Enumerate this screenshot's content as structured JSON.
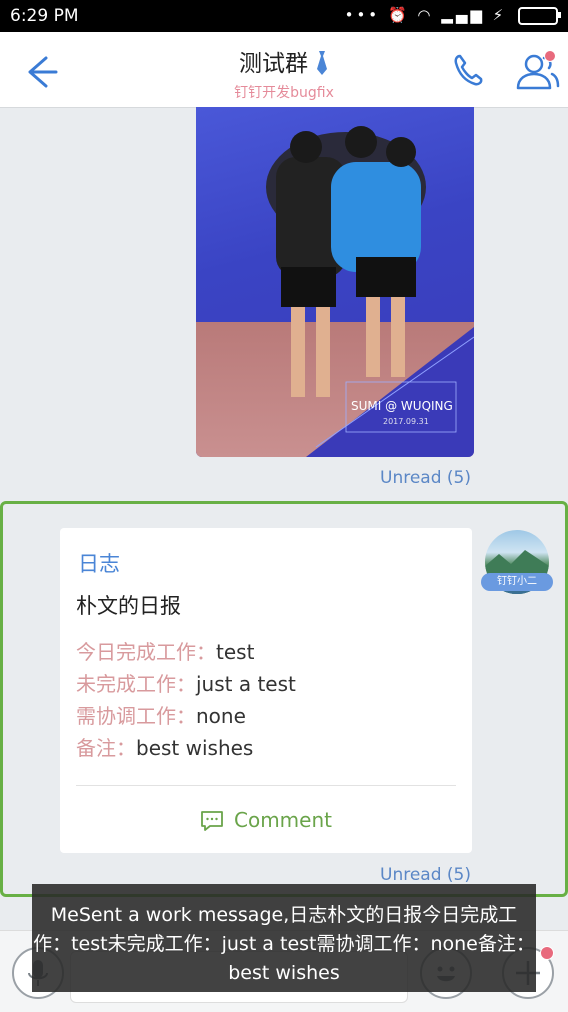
{
  "status_bar": {
    "time": "6:29 PM"
  },
  "header": {
    "title": "测试群",
    "subtitle": "钉钉开发bugfix"
  },
  "photo_message": {
    "caption": "SUMI @ WUQING",
    "caption_date": "2017.09.31",
    "unread": "Unread (5)"
  },
  "log_card": {
    "type_label": "日志",
    "title": "朴文的日报",
    "rows": [
      {
        "key": "今日完成工作：",
        "value": "test"
      },
      {
        "key": "未完成工作：",
        "value": "just a test"
      },
      {
        "key": "需协调工作：",
        "value": "none"
      },
      {
        "key": "备注：",
        "value": "best wishes"
      }
    ],
    "comment_label": "Comment",
    "unread": "Unread (5)"
  },
  "avatar": {
    "tag": "钉钉小二"
  },
  "overlay": {
    "text": "MeSent a work message,日志朴文的日报今日完成工作：test未完成工作：just a test需协调工作：none备注：best wishes"
  },
  "colors": {
    "accent_blue": "#4a85d6",
    "selection_green": "#68b045",
    "key_pink": "#d89a9d",
    "comment_green": "#6aa44a"
  }
}
